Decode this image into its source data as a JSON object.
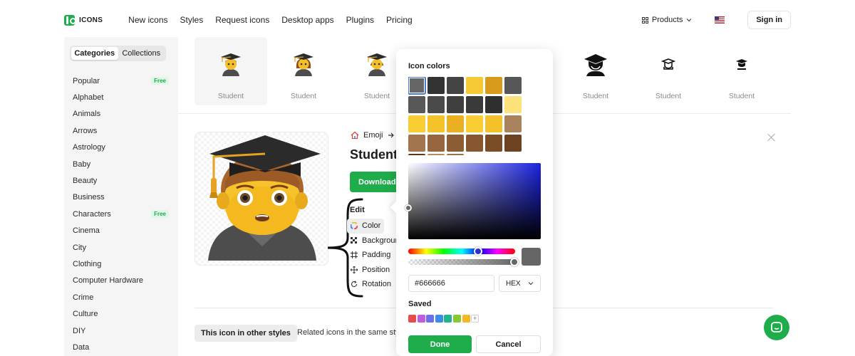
{
  "brand": {
    "name": "ICONS",
    "color": "#1fad4c"
  },
  "nav": {
    "links": [
      "New icons",
      "Styles",
      "Request icons",
      "Desktop apps",
      "Plugins",
      "Pricing"
    ],
    "products": "Products",
    "signin": "Sign in"
  },
  "sidebar": {
    "tabs": [
      "Categories",
      "Collections"
    ],
    "active_tab": "Categories",
    "items": [
      {
        "label": "Popular",
        "badge": "Free"
      },
      {
        "label": "Alphabet",
        "badge": ""
      },
      {
        "label": "Animals",
        "badge": ""
      },
      {
        "label": "Arrows",
        "badge": ""
      },
      {
        "label": "Astrology",
        "badge": ""
      },
      {
        "label": "Baby",
        "badge": ""
      },
      {
        "label": "Beauty",
        "badge": ""
      },
      {
        "label": "Business",
        "badge": ""
      },
      {
        "label": "Characters",
        "badge": "Free"
      },
      {
        "label": "Cinema",
        "badge": ""
      },
      {
        "label": "City",
        "badge": ""
      },
      {
        "label": "Clothing",
        "badge": ""
      },
      {
        "label": "Computer Hardware",
        "badge": ""
      },
      {
        "label": "Crime",
        "badge": ""
      },
      {
        "label": "Culture",
        "badge": ""
      },
      {
        "label": "DIY",
        "badge": ""
      },
      {
        "label": "Data",
        "badge": ""
      }
    ]
  },
  "strip": {
    "items": [
      {
        "label": "Student",
        "style": "emoji-man",
        "selected": true
      },
      {
        "label": "Student",
        "style": "emoji-woman",
        "selected": false
      },
      {
        "label": "Student",
        "style": "emoji-person",
        "selected": false
      },
      {
        "label": "Student",
        "style": "filled-silhouette",
        "selected": false
      },
      {
        "label": "Student",
        "style": "outline-cap",
        "selected": false
      },
      {
        "label": "Student",
        "style": "solid-cap",
        "selected": false
      }
    ]
  },
  "detail": {
    "breadcrumb": [
      "Emoji"
    ],
    "title": "Student",
    "download_label": "Download",
    "edit_title": "Edit",
    "edit_items": [
      {
        "label": "Color",
        "icon": "color-wheel-icon",
        "active": true
      },
      {
        "label": "Background",
        "icon": "checker-icon",
        "active": false
      },
      {
        "label": "Padding",
        "icon": "padding-icon",
        "active": false
      },
      {
        "label": "Position",
        "icon": "move-icon",
        "active": false
      },
      {
        "label": "Rotation",
        "icon": "rotate-icon",
        "active": false
      }
    ],
    "other_styles_tab": "This icon in other styles",
    "related_tab": "Related icons in the same style"
  },
  "color_picker": {
    "title": "Icon colors",
    "swatches": [
      "#666666",
      "#333333",
      "#444444",
      "#f7c936",
      "#d89b1c",
      "#575757",
      "#585858",
      "#4a4a4a",
      "#3f3f3f",
      "#3a3a3a",
      "#2f2f2f",
      "#fbe27a",
      "#f9cd33",
      "#f4c32a",
      "#eab021",
      "#f9ce35",
      "#f3c12a",
      "#a8835d",
      "#a2754e",
      "#96663e",
      "#8c5c34",
      "#87582f",
      "#7a4d25",
      "#6d4220",
      "#5a3a1c",
      "#b88a5d",
      "#9b7046",
      "#ffffff",
      "#ffffff",
      "#ffffff"
    ],
    "hex_value": "#666666",
    "format": "HEX",
    "saved_title": "Saved",
    "saved": [
      "#e74c4c",
      "#c05ce0",
      "#6d6fe6",
      "#3a8ee6",
      "#22b38f",
      "#8ac730",
      "#f2b825"
    ],
    "done": "Done",
    "cancel": "Cancel"
  }
}
